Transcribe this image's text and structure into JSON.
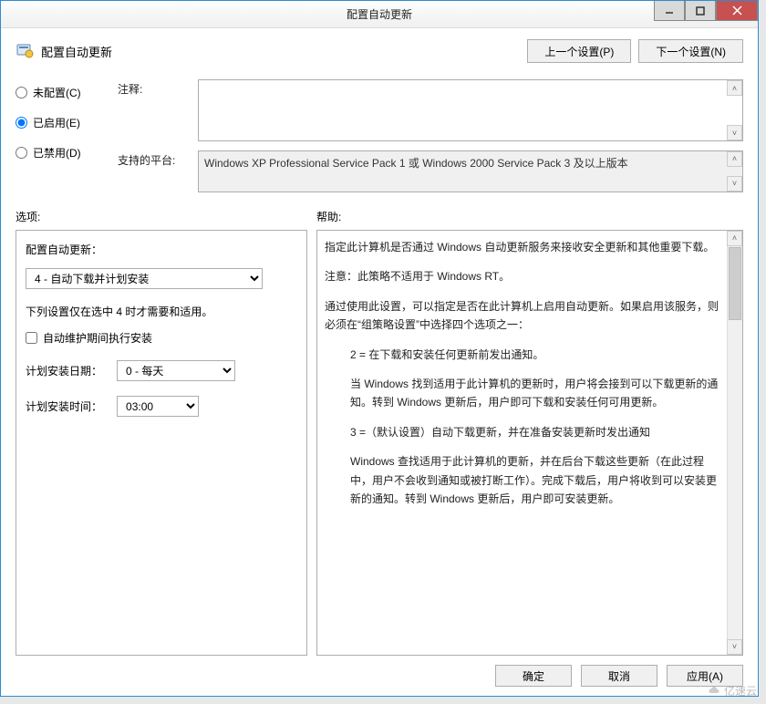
{
  "window": {
    "title": "配置自动更新"
  },
  "header": {
    "title": "配置自动更新",
    "prev_btn": "上一个设置(P)",
    "next_btn": "下一个设置(N)"
  },
  "state": {
    "not_configured": "未配置(C)",
    "enabled": "已启用(E)",
    "disabled": "已禁用(D)",
    "selected": "enabled"
  },
  "comment": {
    "label": "注释:",
    "value": ""
  },
  "platform": {
    "label": "支持的平台:",
    "value": "Windows XP Professional Service Pack 1 或 Windows 2000 Service Pack 3 及以上版本"
  },
  "sections": {
    "options": "选项:",
    "help": "帮助:"
  },
  "options": {
    "configure_label": "配置自动更新：",
    "configure_value": "4 - 自动下载并计划安装",
    "note": "下列设置仅在选中 4 时才需要和适用。",
    "maintenance_checkbox": "自动维护期间执行安装",
    "maintenance_checked": false,
    "schedule_day_label": "计划安装日期：",
    "schedule_day_value": "0 - 每天",
    "schedule_time_label": "计划安装时间：",
    "schedule_time_value": "03:00"
  },
  "help": {
    "p1": "指定此计算机是否通过 Windows 自动更新服务来接收安全更新和其他重要下载。",
    "p2": "注意：此策略不适用于 Windows RT。",
    "p3": "通过使用此设置，可以指定是否在此计算机上启用自动更新。如果启用该服务，则必须在“组策略设置”中选择四个选项之一：",
    "opt2": "2 = 在下载和安装任何更新前发出通知。",
    "opt2_desc": "当 Windows 找到适用于此计算机的更新时，用户将会接到可以下载更新的通知。转到 Windows 更新后，用户即可下载和安装任何可用更新。",
    "opt3": "3 =（默认设置）自动下载更新，并在准备安装更新时发出通知",
    "opt3_desc": "Windows 查找适用于此计算机的更新，并在后台下载这些更新（在此过程中，用户不会收到通知或被打断工作）。完成下载后，用户将收到可以安装更新的通知。转到 Windows 更新后，用户即可安装更新。"
  },
  "footer": {
    "ok": "确定",
    "cancel": "取消",
    "apply": "应用(A)"
  },
  "watermark": "亿速云"
}
